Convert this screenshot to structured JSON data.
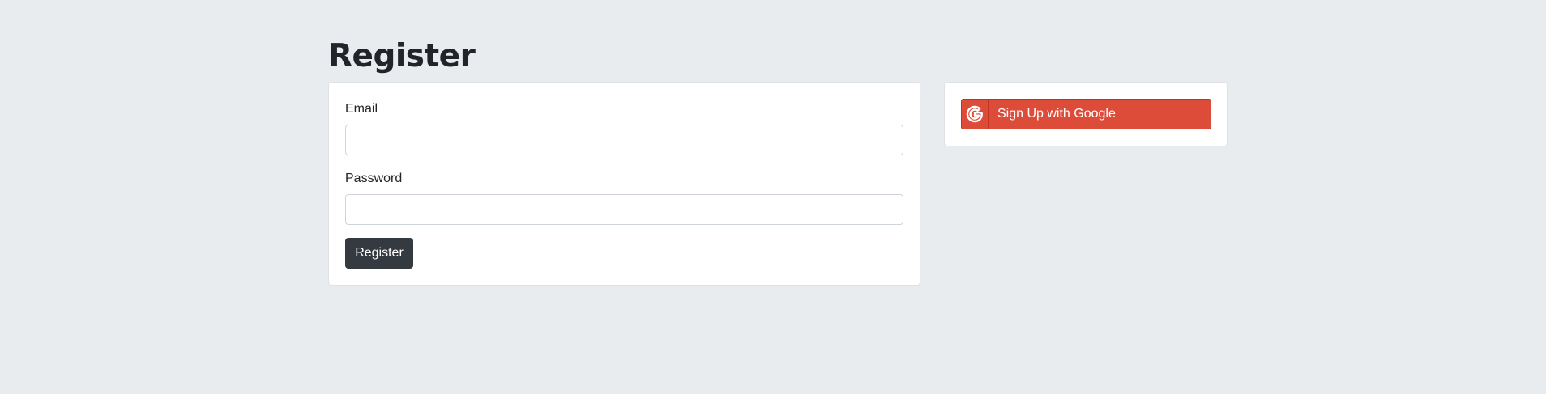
{
  "page": {
    "title": "Register"
  },
  "form": {
    "email_label": "Email",
    "email_value": "",
    "email_placeholder": "",
    "password_label": "Password",
    "password_value": "",
    "password_placeholder": "",
    "submit_label": "Register"
  },
  "social": {
    "google_label": "Sign Up with Google",
    "google_icon": "google-icon",
    "google_color": "#dd4b39"
  },
  "colors": {
    "background": "#e9ecef",
    "card": "#ffffff",
    "primary_dark": "#343a40"
  }
}
